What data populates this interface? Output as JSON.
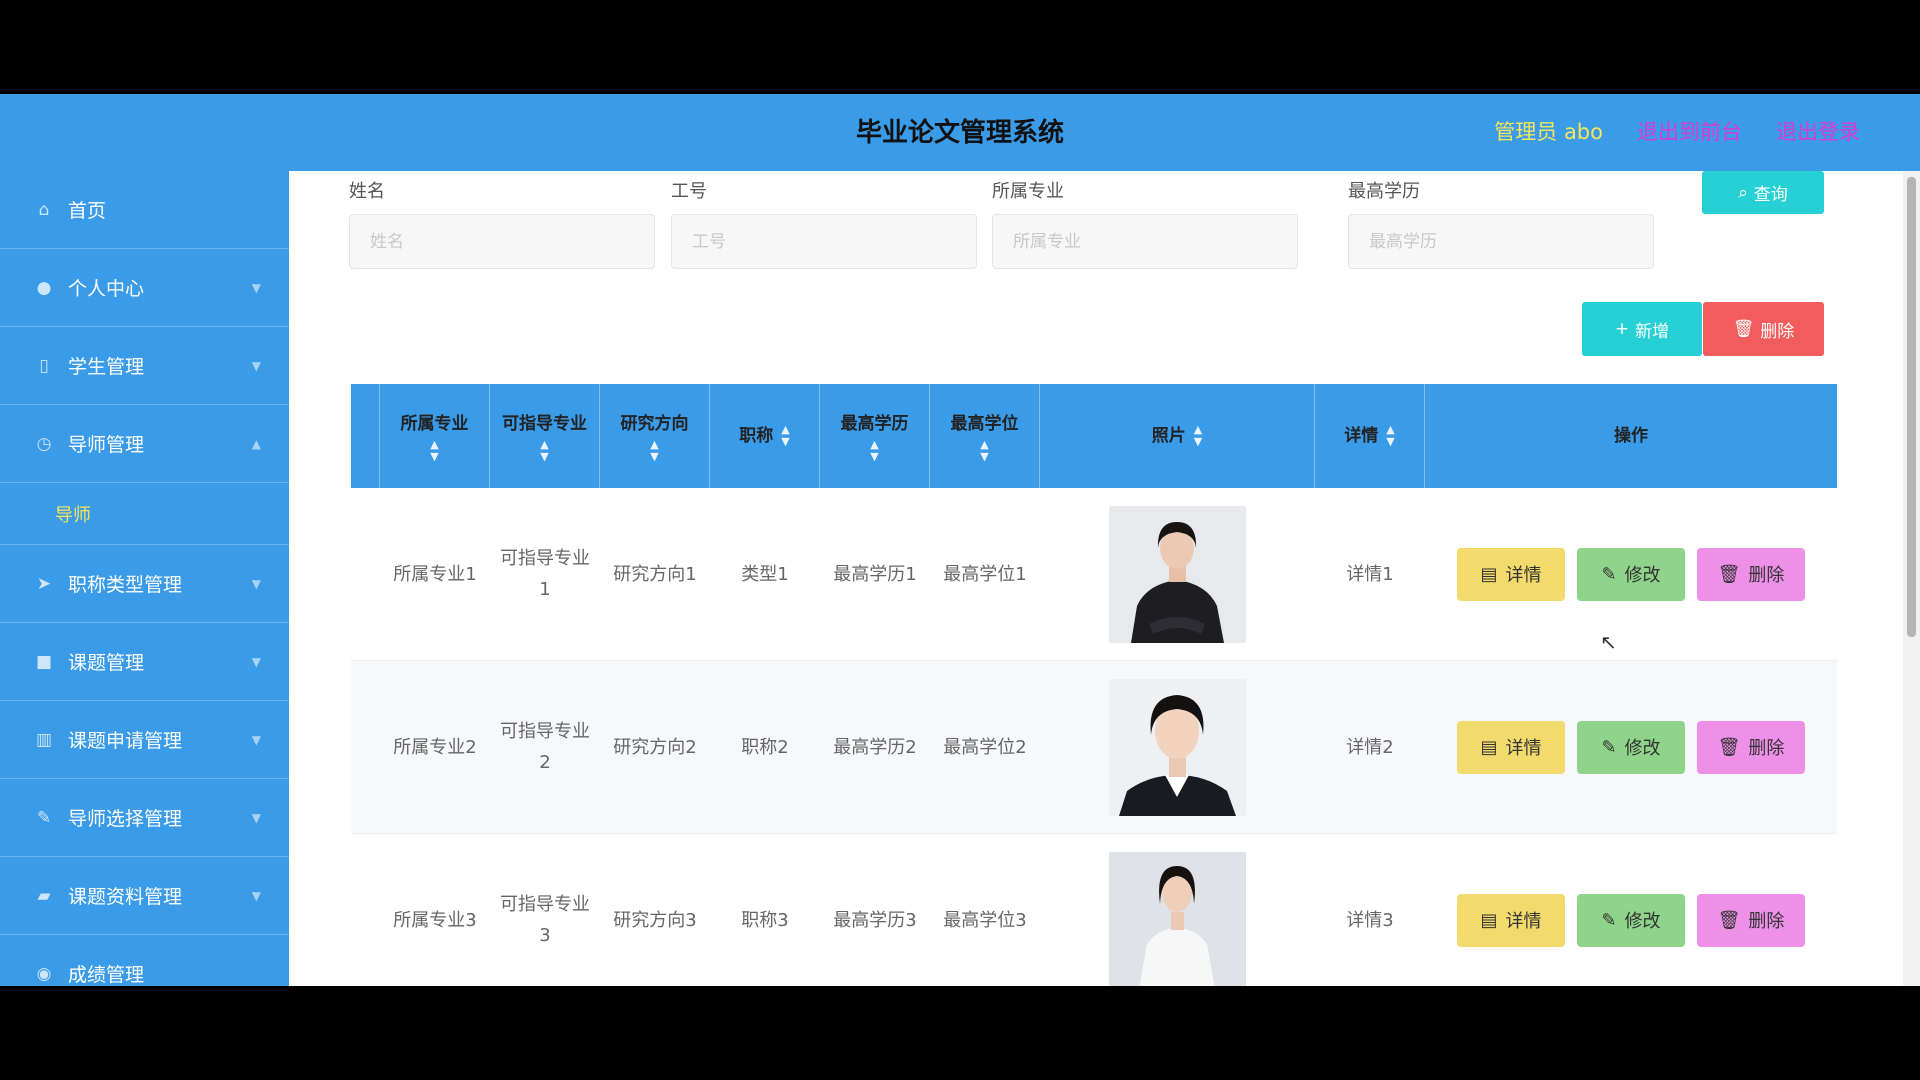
{
  "header": {
    "title": "毕业论文管理系统",
    "admin": "管理员 abo",
    "exit_front": "退出到前台",
    "logout": "退出登录"
  },
  "sidebar": {
    "items": [
      {
        "label": "首页",
        "icon": "home-icon"
      },
      {
        "label": "个人中心",
        "icon": "user-icon"
      },
      {
        "label": "学生管理",
        "icon": "student-icon"
      },
      {
        "label": "导师管理",
        "icon": "clock-icon"
      },
      {
        "label": "职称类型管理",
        "icon": "send-icon"
      },
      {
        "label": "课题管理",
        "icon": "folder-icon"
      },
      {
        "label": "课题申请管理",
        "icon": "chart-icon"
      },
      {
        "label": "导师选择管理",
        "icon": "edit-icon"
      },
      {
        "label": "课题资料管理",
        "icon": "chat-icon"
      },
      {
        "label": "成绩管理",
        "icon": "grade-icon"
      }
    ],
    "sub_item": "导师"
  },
  "search": {
    "fields": [
      {
        "label": "姓名",
        "placeholder": "姓名"
      },
      {
        "label": "工号",
        "placeholder": "工号"
      },
      {
        "label": "所属专业",
        "placeholder": "所属专业"
      },
      {
        "label": "最高学历",
        "placeholder": "最高学历"
      }
    ],
    "query_label": "查询"
  },
  "actions": {
    "add_label": "新增",
    "delete_label": "删除"
  },
  "table": {
    "columns": [
      "所属专业",
      "可指导专业",
      "研究方向",
      "职称",
      "最高学历",
      "最高学位",
      "照片",
      "详情",
      "操作"
    ],
    "rows": [
      {
        "major": "所属专业1",
        "guide": "可指导专业1",
        "direction": "研究方向1",
        "title": "类型1",
        "edu": "最高学历1",
        "degree": "最高学位1",
        "detail": "详情1"
      },
      {
        "major": "所属专业2",
        "guide": "可指导专业2",
        "direction": "研究方向2",
        "title": "职称2",
        "edu": "最高学历2",
        "degree": "最高学位2",
        "detail": "详情2"
      },
      {
        "major": "所属专业3",
        "guide": "可指导专业3",
        "direction": "研究方向3",
        "title": "职称3",
        "edu": "最高学历3",
        "degree": "最高学位3",
        "detail": "详情3"
      }
    ],
    "op_detail": "详情",
    "op_edit": "修改",
    "op_delete": "删除"
  },
  "colors": {
    "primary": "#3a9be8",
    "cyan": "#27d0d5",
    "red": "#f25c5c",
    "yellow": "#f2da6d",
    "green": "#8fd48a",
    "pink": "#ee8fe8"
  }
}
